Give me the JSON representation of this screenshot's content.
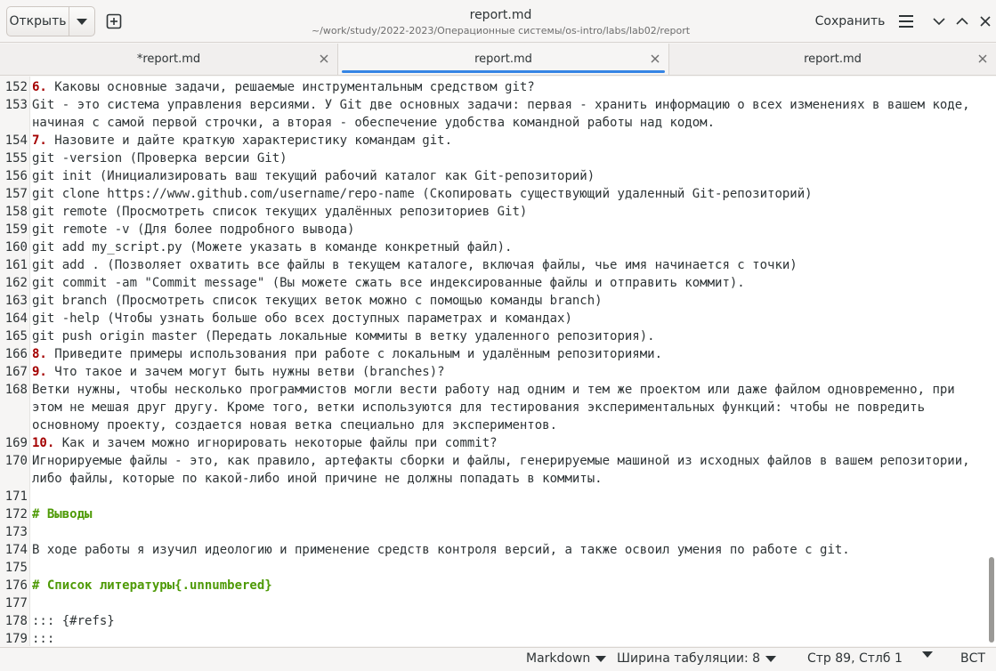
{
  "header": {
    "open_label": "Открыть",
    "title": "report.md",
    "path": "~/work/study/2022-2023/Операционные системы/os-intro/labs/lab02/report",
    "save_label": "Сохранить"
  },
  "tabs": [
    {
      "label": "*report.md"
    },
    {
      "label": "report.md"
    },
    {
      "label": "report.md"
    }
  ],
  "lines": [
    {
      "n": "152",
      "num": "6.",
      "text": " Каковы основные задачи, решаемые инструментальным средством git?"
    },
    {
      "n": "153",
      "text": "Git - это система управления версиями. У Git две основных задачи: первая - хранить информацию о всех изменениях в вашем коде, начиная с самой первой строчки, а вторая - обеспечение удобства командной работы над кодом."
    },
    {
      "n": "154",
      "num": "7.",
      "text": " Назовите и дайте краткую характеристику командам git."
    },
    {
      "n": "155",
      "text": "git -version (Проверка версии Git)"
    },
    {
      "n": "156",
      "text": "git init (Инициализировать ваш текущий рабочий каталог как Git-репозиторий)"
    },
    {
      "n": "157",
      "text": "git clone https://www.github.com/username/repo-name (Скопировать существующий удаленный Git-репозиторий)"
    },
    {
      "n": "158",
      "text": "git remote (Просмотреть список текущих удалённых репозиториев Git)"
    },
    {
      "n": "159",
      "text": "git remote -v (Для более подробного вывода)"
    },
    {
      "n": "160",
      "text": "git add my_script.py (Можете указать в команде конкретный файл)."
    },
    {
      "n": "161",
      "text": "git add . (Позволяет охватить все файлы в текущем каталоге, включая файлы, чье имя начинается с точки)"
    },
    {
      "n": "162",
      "text": "git commit -am \"Commit message\" (Вы можете сжать все индексированные файлы и отправить коммит)."
    },
    {
      "n": "163",
      "text": "git branch (Просмотреть список текущих веток можно с помощью команды branch)"
    },
    {
      "n": "164",
      "text": "git -help (Чтобы узнать больше обо всех доступных параметрах и командах)"
    },
    {
      "n": "165",
      "text": "git push origin master (Передать локальные коммиты в ветку удаленного репозитория)."
    },
    {
      "n": "166",
      "num": "8.",
      "text": " Приведите примеры использования при работе с локальным и удалённым репозиториями."
    },
    {
      "n": "167",
      "num": "9.",
      "text": " Что такое и зачем могут быть нужны ветви (branches)?"
    },
    {
      "n": "168",
      "text": "Ветки нужны, чтобы несколько программистов могли вести работу над одним и тем же проектом или даже файлом одновременно, при этом не мешая друг другу. Кроме того, ветки используются для тестирования экспериментальных функций: чтобы не повредить основному проекту, создается новая ветка специально для экспериментов."
    },
    {
      "n": "169",
      "num": "10.",
      "text": " Как и зачем можно игнорировать некоторые файлы при commit?"
    },
    {
      "n": "170",
      "text": "Игнорируемые файлы - это, как правило, артефакты сборки и файлы, генерируемые машиной из исходных файлов в вашем репозитории, либо файлы, которые по какой-либо иной причине не должны попадать в коммиты."
    },
    {
      "n": "171",
      "text": ""
    },
    {
      "n": "172",
      "head": "# Выводы",
      "text": ""
    },
    {
      "n": "173",
      "text": ""
    },
    {
      "n": "174",
      "text": "В ходе работы я изучил идеологию и применение средств контроля версий, а также освоил умения по работе с git."
    },
    {
      "n": "175",
      "text": ""
    },
    {
      "n": "176",
      "head": "# Список литературы{.unnumbered}",
      "text": ""
    },
    {
      "n": "177",
      "text": ""
    },
    {
      "n": "178",
      "text": "::: {#refs}"
    },
    {
      "n": "179",
      "text": ":::"
    }
  ],
  "status": {
    "language": "Markdown",
    "tab_width": "Ширина табуляции: 8",
    "position": "Стр 89, Стлб 1",
    "mode": "ВСТ"
  },
  "icons": {
    "menu": "hamburger-icon",
    "minimize": "chevron-down-icon",
    "maximize": "chevron-up-icon",
    "close": "close-icon",
    "new_tab": "new-tab-icon"
  },
  "colors": {
    "accent": "#3584e4",
    "list_number": "#a40000",
    "heading": "#4e9a06"
  }
}
